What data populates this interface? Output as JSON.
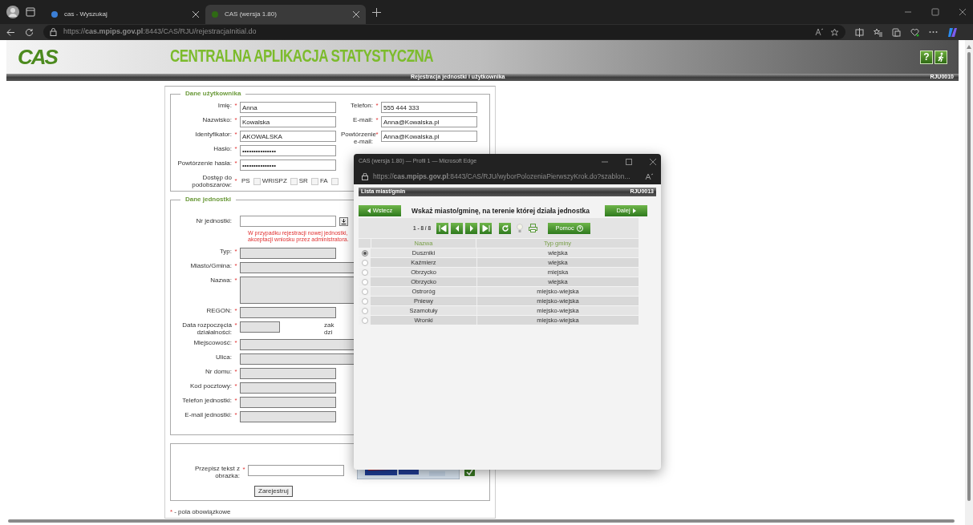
{
  "browser": {
    "tabs": [
      {
        "title": "cas - Wyszukaj",
        "selected": false
      },
      {
        "title": "CAS (wersja 1.80)",
        "selected": true
      }
    ],
    "url": "https://**cas.mpips.gov.pl**:8443/CAS/RJU/rejestracjaInitial.do"
  },
  "header": {
    "logo": "CAS",
    "title": "CENTRALNA APLIKACJA STATYSTYCZNA",
    "help_button": "?"
  },
  "page_bar": {
    "title": "Rejestracja jednostki i użytkownika",
    "code": "RJU0010"
  },
  "user_section": {
    "legend": "Dane użytkownika",
    "left_fields": [
      {
        "label": "Imię:",
        "required_mark": "*",
        "value": "Anna",
        "kind": "normal",
        "disabled": false
      },
      {
        "label": "Nazwisko:",
        "required_mark": "*",
        "value": "Kowalska",
        "kind": "normal",
        "disabled": false
      },
      {
        "label": "Identyfikator:",
        "required_mark": "*",
        "value": "AKOWALSKA",
        "kind": "normal",
        "disabled": false
      },
      {
        "label": "Hasło:",
        "required_mark": "*",
        "value": "•••••••••••••••",
        "kind": "normal",
        "disabled": false
      },
      {
        "label": "Powtórzenie hasła:",
        "required_mark": "*",
        "value": "•••••••••••••••",
        "kind": "normal",
        "disabled": false
      }
    ],
    "right_fields": [
      {
        "label": "Telefon:",
        "required_mark": "*",
        "value": "555 444 333",
        "kind": "normal",
        "disabled": false
      },
      {
        "label": "E-mail:",
        "required_mark": "*",
        "value": "Anna@Kowalska.pl",
        "kind": "normal",
        "disabled": false
      },
      {
        "label": "Powtórzenie e-mail:",
        "required_mark": "*",
        "value": "Anna@Kowalska.pl",
        "kind": "normal",
        "disabled": false
      }
    ],
    "access": {
      "label": "Dostęp do podobszarów:",
      "required_mark": "*",
      "options": [
        {
          "label": "PS",
          "checked": false
        },
        {
          "label": "WRISPZ",
          "checked": false
        },
        {
          "label": "SR",
          "checked": false
        },
        {
          "label": "FA",
          "checked": false
        }
      ]
    }
  },
  "unit_section": {
    "legend": "Dane jednostki",
    "unit_number": {
      "label": "Nr jednostki:"
    },
    "warning": [
      "W przypadku rejestracji nowej jednostki,",
      "akceptacji wniosku przez administratora."
    ],
    "fields": [
      {
        "label": "Typ:",
        "required_mark": "*",
        "kind": "normal",
        "disabled": true
      },
      {
        "label": "Miasto/Gmina:",
        "required_mark": "*",
        "kind": "wide",
        "disabled": true
      },
      {
        "label": "Nazwa:",
        "required_mark": "*",
        "kind": "tall",
        "disabled": true
      },
      {
        "label": "REGON:",
        "required_mark": "*",
        "kind": "normal",
        "disabled": true
      },
      {
        "label": "Data rozpoczęcia działalności:",
        "required_mark": "*",
        "kind": "short",
        "disabled": true,
        "side_label": "zak dzi"
      },
      {
        "label": "Miejscowość:",
        "required_mark": "*",
        "kind": "wide",
        "disabled": true
      },
      {
        "label": "Ulica:",
        "kind": "wide",
        "disabled": true
      },
      {
        "label": "Nr domu:",
        "required_mark": "*",
        "kind": "normal",
        "disabled": true
      },
      {
        "label": "Kod pocztowy:",
        "required_mark": "*",
        "kind": "normal",
        "disabled": true
      },
      {
        "label": "Telefon jednostki:",
        "required_mark": "*",
        "kind": "normal",
        "disabled": true
      },
      {
        "label": "E-mail jednostki:",
        "required_mark": "*",
        "kind": "normal",
        "disabled": true
      }
    ]
  },
  "captcha_section": {
    "label": "Przepisz tekst z obrazka:",
    "required_mark": "*",
    "submit_button": "Zarejestruj"
  },
  "footer": {
    "mark": "*",
    "text": "- pola obowiązkowe"
  },
  "popup": {
    "title": "CAS (wersja 1.80) — Profil 1 — Microsoft Edge",
    "url": "https://**cas.mpips.gov.pl**:8443/CAS/RJU/wyborPolozeniaPierwszyKrok.do?szablon...",
    "bar_title": "Lista miast/gmin",
    "bar_code": "RJU0013",
    "back_button": "Wstecz",
    "next_button": "Dalej",
    "prompt": "Wskaż miasto/gminę, na terenie której działa jednostka",
    "pager": "1 - 8 / 8",
    "help_button": "Pomoc",
    "columns": [
      "Nazwa",
      "Typ gminy"
    ],
    "rows": [
      {
        "name": "Duszniki",
        "type": "wiejska",
        "selected": true
      },
      {
        "name": "Kaźmierz",
        "type": "wiejska",
        "selected": false
      },
      {
        "name": "Obrzycko",
        "type": "miejska",
        "selected": false
      },
      {
        "name": "Obrzycko",
        "type": "wiejska",
        "selected": false
      },
      {
        "name": "Ostroróg",
        "type": "miejsko-wiejska",
        "selected": false
      },
      {
        "name": "Pniewy",
        "type": "miejsko-wiejska",
        "selected": false
      },
      {
        "name": "Szamotuły",
        "type": "miejsko-wiejska",
        "selected": false
      },
      {
        "name": "Wronki",
        "type": "miejsko-wiejska",
        "selected": false
      }
    ]
  }
}
